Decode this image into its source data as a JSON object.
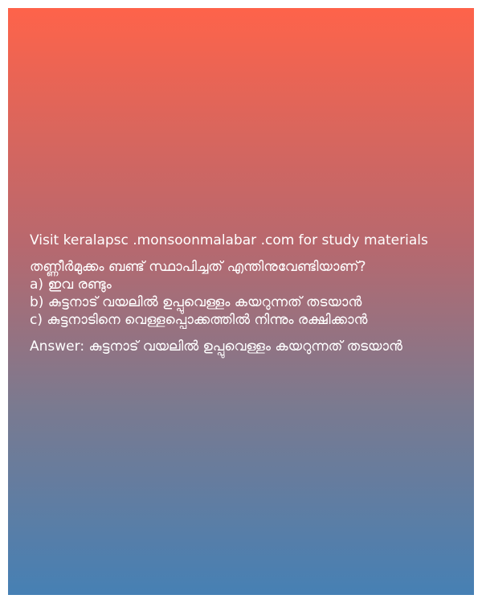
{
  "header": {
    "visit_text": "Visit keralapsc .monsoonmalabar .com for study materials"
  },
  "question": {
    "text": " തണ്ണീർമുക്കം ബണ്ട് സ്ഥാപിച്ചത് എന്തിനുവേണ്ടിയാണ്?",
    "options": [
      "a) ഇവ രണ്ടും",
      "b) കുട്ടനാട് വയലിൽ ഉപ്പുവെള്ളം കയറുന്നത് തടയാൻ",
      "c) കുട്ടനാടിനെ വെള്ളപ്പൊക്കത്തിൽ നിന്നും രക്ഷിക്കാൻ"
    ]
  },
  "answer": {
    "text": "Answer: കുട്ടനാട് വയലിൽ ഉപ്പുവെള്ളം കയറുന്നത് തടയാൻ"
  },
  "colors": {
    "gradient_top": "#fe634a",
    "gradient_bottom": "#4680b4",
    "text": "#ffffff"
  }
}
